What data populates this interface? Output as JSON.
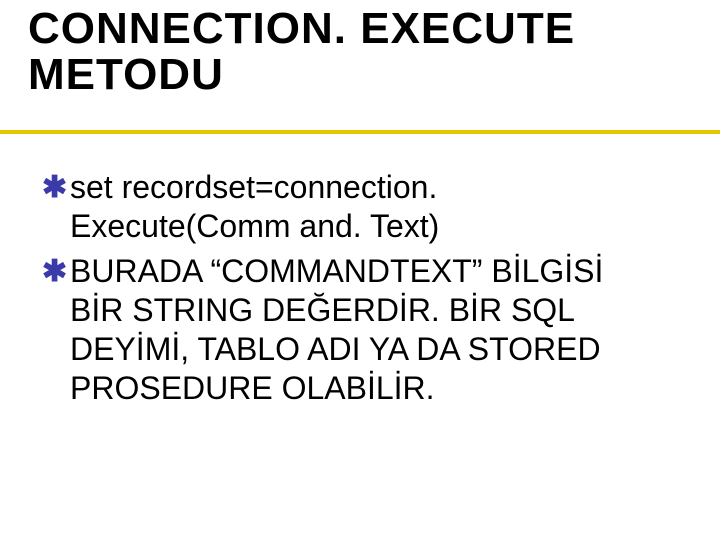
{
  "title": "CONNECTION. EXECUTE METODU",
  "bullets": [
    {
      "glyph": "✱",
      "text": "set recordset=connection. Execute(Comm and. Text)"
    },
    {
      "glyph": "✱",
      "text": "BURADA “COMMANDTEXT” BİLGİSİ BİR STRING DEĞERDİR. BİR SQL DEYİMİ, TABLO ADI YA DA STORED PROSEDURE OLABİLİR."
    }
  ]
}
